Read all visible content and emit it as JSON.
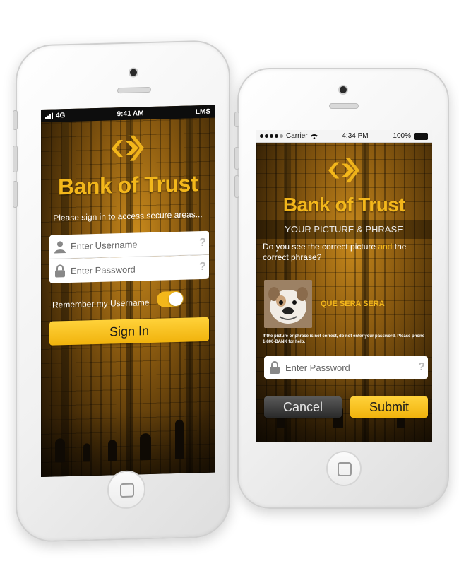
{
  "login_phone": {
    "status": {
      "network": "4G",
      "time": "9:41 AM",
      "carrier_right": "LMS"
    },
    "brand": "Bank of Trust",
    "subtitle": "Please sign in to access secure areas...",
    "username": {
      "placeholder": "Enter Username",
      "help": "?"
    },
    "password": {
      "placeholder": "Enter Password",
      "help": "?"
    },
    "remember": {
      "label": "Remember my Username",
      "checked": true
    },
    "sign_in_label": "Sign In"
  },
  "verify_phone": {
    "status": {
      "carrier": "Carrier",
      "time": "4:34 PM",
      "battery": "100%"
    },
    "brand": "Bank of Trust",
    "header": "YOUR PICTURE & PHRASE",
    "question_a": "Do you see the correct picture ",
    "question_and": "and",
    "question_b": " the correct phrase?",
    "phrase": "QUE SERA SERA",
    "warning": "If the picture or phrase is not correct, do not enter your password. Please phone 1-800-BANK for help.",
    "password": {
      "placeholder": "Enter Password",
      "help": "?"
    },
    "cancel_label": "Cancel",
    "submit_label": "Submit"
  },
  "colors": {
    "brand_yellow": "#f3b71b",
    "button_yellow": "#ffd23a",
    "screen_bg": "#8a5a10"
  },
  "icons": [
    "logo-chevron-icon",
    "user-icon",
    "lock-icon",
    "wifi-icon",
    "signal-icon",
    "battery-icon",
    "home-icon"
  ]
}
